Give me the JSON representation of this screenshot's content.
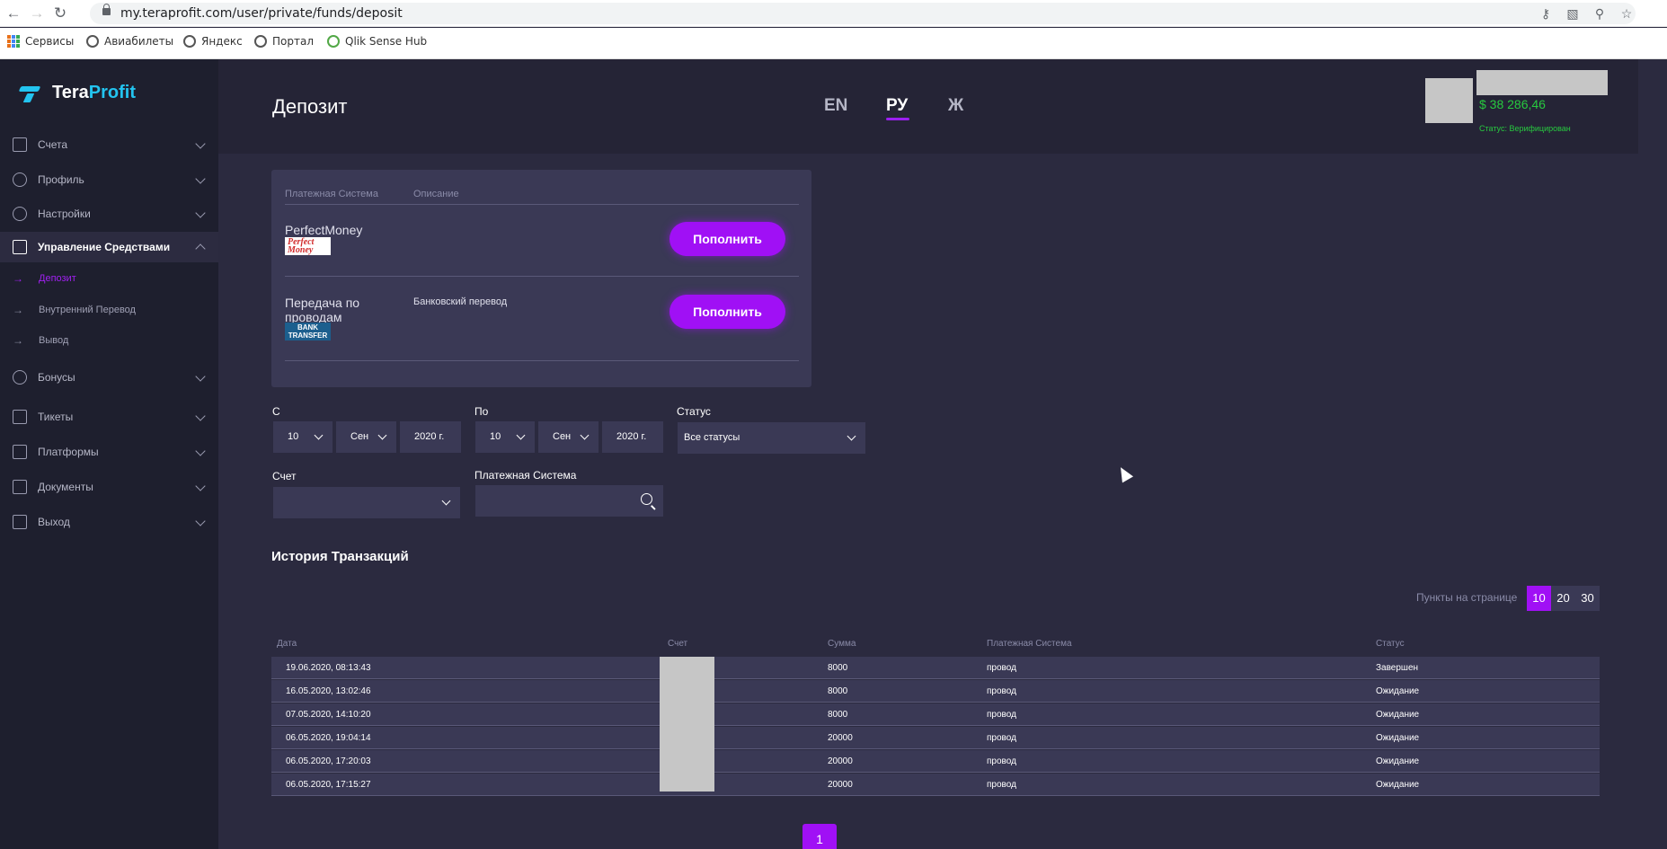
{
  "browser": {
    "url": "my.teraprofit.com/user/private/funds/deposit",
    "bookmarks": [
      "Сервисы",
      "Авиабилеты",
      "Яндекс",
      "Портал",
      "Qlik Sense Hub"
    ]
  },
  "brand": {
    "name_part1": "Tera",
    "name_part2": "Profit",
    "accent": "#23c4f0"
  },
  "sidebar": {
    "items": [
      {
        "label": "Счета",
        "icon": "wallet-icon"
      },
      {
        "label": "Профиль",
        "icon": "user-icon"
      },
      {
        "label": "Настройки",
        "icon": "gear-icon"
      },
      {
        "label": "Управление Средствами",
        "icon": "card-icon"
      },
      {
        "label": "Бонусы",
        "icon": "gift-icon"
      },
      {
        "label": "Тикеты",
        "icon": "ticket-icon"
      },
      {
        "label": "Платформы",
        "icon": "platform-icon"
      },
      {
        "label": "Документы",
        "icon": "document-icon"
      },
      {
        "label": "Выход",
        "icon": "logout-icon"
      }
    ],
    "subitems": [
      {
        "label": "Депозит",
        "active": true
      },
      {
        "label": "Внутренний Перевод",
        "active": false
      },
      {
        "label": "Вывод",
        "active": false
      }
    ]
  },
  "header": {
    "title": "Депозит",
    "languages": [
      "EN",
      "РУ",
      "Ж"
    ],
    "active_language": "РУ",
    "balance": "$ 38 286,46",
    "status": "Статус: Верифицирован"
  },
  "payment": {
    "col_system": "Платежная Система",
    "col_description": "Описание",
    "methods": [
      {
        "name": "PerfectMoney",
        "description": "",
        "logo": "Perfect Money",
        "button": "Пополнить"
      },
      {
        "name": "Передача по проводам",
        "description": "Банковский перевод",
        "logo": "BANK TRANSFER",
        "button": "Пополнить"
      }
    ]
  },
  "filters": {
    "from_label": "С",
    "to_label": "По",
    "status_label": "Статус",
    "from": {
      "day": "10",
      "month": "Сен",
      "year": "2020 г."
    },
    "to": {
      "day": "10",
      "month": "Сен",
      "year": "2020 г."
    },
    "status_value": "Все статусы",
    "account_label": "Счет",
    "account_value": "",
    "system_label": "Платежная Система",
    "system_value": ""
  },
  "history": {
    "title": "История Транзакций",
    "per_page_label": "Пункты на странице",
    "per_page_options": [
      "10",
      "20",
      "30"
    ],
    "per_page_selected": "10",
    "columns": [
      "Дата",
      "Счет",
      "Сумма",
      "Платежная Система",
      "Статус"
    ],
    "rows": [
      {
        "date": "19.06.2020, 08:13:43",
        "account": "",
        "amount": "8000",
        "system": "провод",
        "status": "Завершен"
      },
      {
        "date": "16.05.2020, 13:02:46",
        "account": "",
        "amount": "8000",
        "system": "провод",
        "status": "Ожидание"
      },
      {
        "date": "07.05.2020, 14:10:20",
        "account": "",
        "amount": "8000",
        "system": "провод",
        "status": "Ожидание"
      },
      {
        "date": "06.05.2020, 19:04:14",
        "account": "",
        "amount": "20000",
        "system": "провод",
        "status": "Ожидание"
      },
      {
        "date": "06.05.2020, 17:20:03",
        "account": "",
        "amount": "20000",
        "system": "провод",
        "status": "Ожидание"
      },
      {
        "date": "06.05.2020, 17:15:27",
        "account": "",
        "amount": "20000",
        "system": "провод",
        "status": "Ожидание"
      }
    ],
    "page": "1"
  },
  "colors": {
    "accent": "#a010f5",
    "success": "#27c93f",
    "sidebar_bg": "#1e1f2e",
    "content_bg": "#2b2a3f"
  }
}
